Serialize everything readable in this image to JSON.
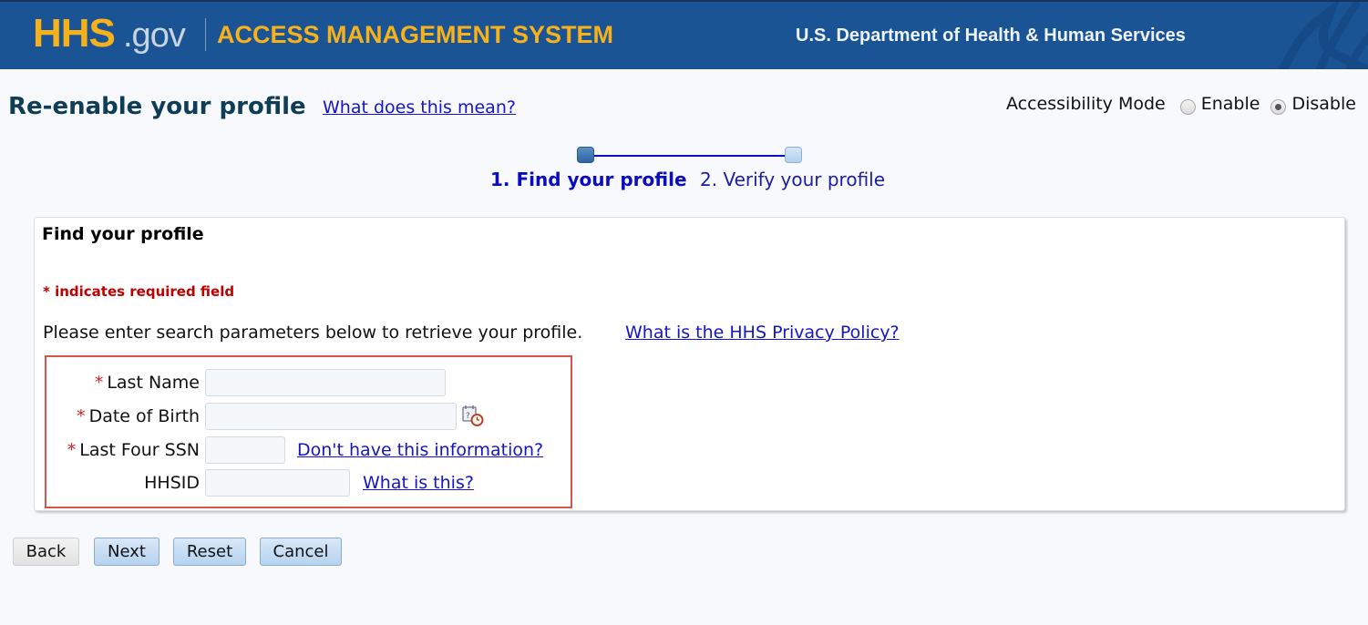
{
  "header": {
    "logo_main": "HHS",
    "logo_suffix": ".gov",
    "app_name": "ACCESS MANAGEMENT SYSTEM",
    "department": "U.S. Department of Health & Human Services",
    "colors": {
      "background": "#1a5495",
      "accent": "#f7b21b"
    }
  },
  "title_row": {
    "page_title": "Re-enable your profile",
    "help_link": "What does this mean?",
    "accessibility": {
      "label": "Accessibility Mode",
      "options": [
        {
          "label": "Enable",
          "checked": false
        },
        {
          "label": "Disable",
          "checked": true
        }
      ]
    }
  },
  "steps": {
    "items": [
      {
        "label": "1. Find your profile",
        "active": true
      },
      {
        "label": "2. Verify your profile",
        "active": false
      }
    ]
  },
  "panel": {
    "title": "Find your profile",
    "required_note": "* indicates required field",
    "instructions": "Please enter search parameters below to retrieve your profile.",
    "privacy_link": "What is the HHS Privacy Policy?",
    "fields": [
      {
        "label": "Last Name",
        "required": true,
        "value": "",
        "placeholder": ""
      },
      {
        "label": "Date of Birth",
        "required": true,
        "value": "",
        "placeholder": "",
        "icon": "calendar-clock-icon"
      },
      {
        "label": "Last Four SSN",
        "required": true,
        "value": "",
        "placeholder": "",
        "link": "Don't have this information?"
      },
      {
        "label": "HHSID",
        "required": false,
        "value": "",
        "placeholder": "",
        "link": "What is this?"
      }
    ],
    "required_marker": "*"
  },
  "buttons": {
    "back": "Back",
    "next": "Next",
    "reset": "Reset",
    "cancel": "Cancel"
  }
}
